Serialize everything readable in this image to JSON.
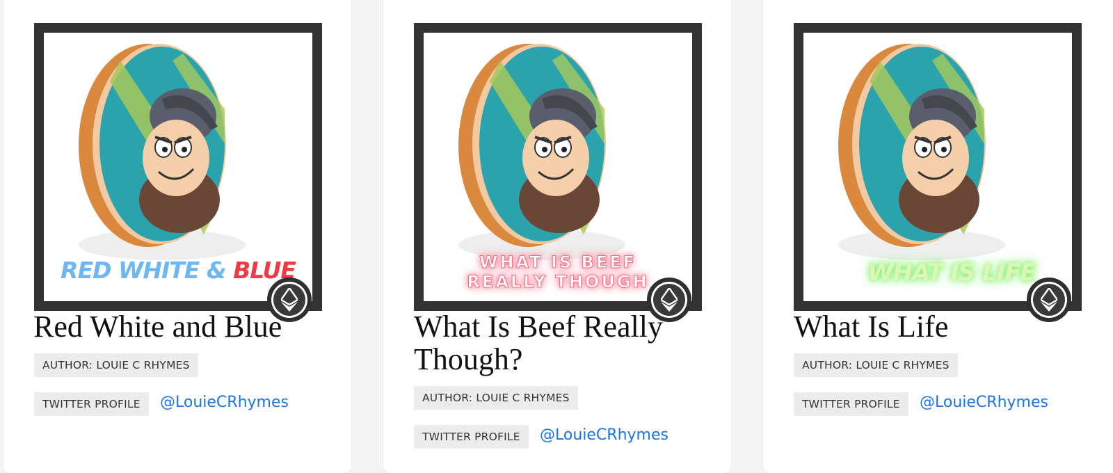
{
  "cards": [
    {
      "title": "Red White and Blue",
      "art_text_a": "RED WHITE & ",
      "art_text_b": "BLUE",
      "author_label": "AUTHOR: LOUIE C RHYMES",
      "twitter_label": "TWITTER PROFILE",
      "twitter_handle": "@LouieCRhymes"
    },
    {
      "title": "What Is Beef Really Though?",
      "art_text_a": "WHAT IS BEEF",
      "art_text_b": "REALLY THOUGH",
      "author_label": "AUTHOR: LOUIE C RHYMES",
      "twitter_label": "TWITTER PROFILE",
      "twitter_handle": "@LouieCRhymes"
    },
    {
      "title": "What Is Life",
      "art_text_a": "WHAT IS LIFE",
      "author_label": "AUTHOR: LOUIE C RHYMES",
      "twitter_label": "TWITTER PROFILE",
      "twitter_handle": "@LouieCRhymes"
    }
  ],
  "icons": {
    "badge": "ethereum-icon"
  },
  "colors": {
    "link": "#1a73e8",
    "frame": "#333333",
    "tag_bg": "#ececec"
  }
}
